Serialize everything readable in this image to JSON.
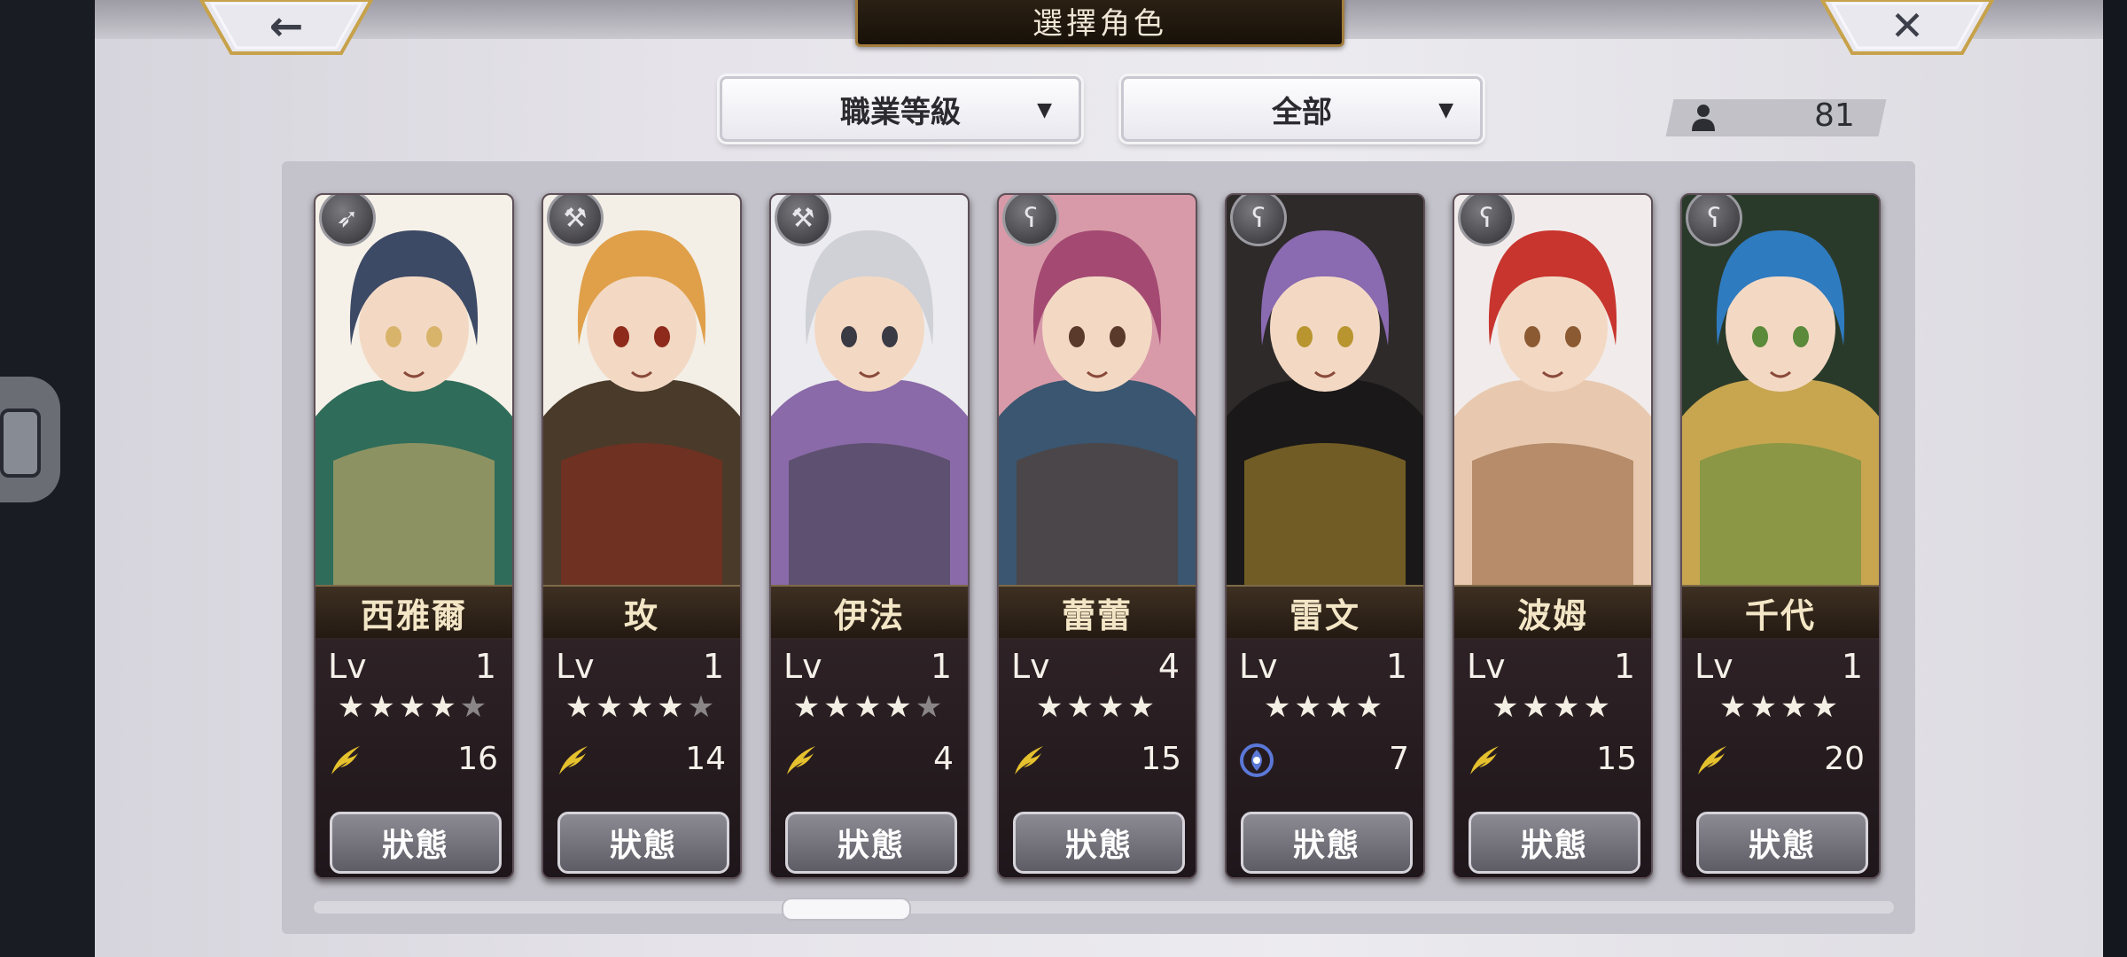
{
  "header": {
    "title": "選擇角色",
    "back_icon": "←",
    "close_icon": "✕"
  },
  "filters": {
    "job": {
      "label": "職業等級",
      "caret": "▼"
    },
    "scope": {
      "label": "全部",
      "caret": "▼"
    }
  },
  "owned_count": {
    "icon": "person-icon",
    "value": "81"
  },
  "cards": [
    {
      "name": "西雅爾",
      "class_icon": "bow-icon",
      "class_glyph": "➶",
      "level_label": "Lv",
      "level": "1",
      "stars_filled": 4,
      "stars_total": 5,
      "element_icon": "wind-feather-icon",
      "element_value": "16",
      "status": "狀態",
      "palette": [
        "#f6f1e8",
        "#3d4a66",
        "#d8b36a",
        "#2f6c5a"
      ]
    },
    {
      "name": "玫",
      "class_icon": "hammer-icon",
      "class_glyph": "⚒",
      "level_label": "Lv",
      "level": "1",
      "stars_filled": 4,
      "stars_total": 5,
      "element_icon": "wind-feather-icon",
      "element_value": "14",
      "status": "狀態",
      "palette": [
        "#f3efe7",
        "#e0a04a",
        "#8e2a1c",
        "#4a3a2a"
      ]
    },
    {
      "name": "伊法",
      "class_icon": "hammer-icon",
      "class_glyph": "⚒",
      "level_label": "Lv",
      "level": "1",
      "stars_filled": 4,
      "stars_total": 5,
      "element_icon": "wind-feather-icon",
      "element_value": "4",
      "status": "狀態",
      "palette": [
        "#ecebef",
        "#cfd1d6",
        "#3a3a44",
        "#8a6aa8"
      ]
    },
    {
      "name": "蕾蕾",
      "class_icon": "staff-icon",
      "class_glyph": "ʕ",
      "level_label": "Lv",
      "level": "4",
      "stars_filled": 4,
      "stars_total": 4,
      "element_icon": "wind-feather-icon",
      "element_value": "15",
      "status": "狀態",
      "palette": [
        "#d89aa8",
        "#a44a72",
        "#5a3a2a",
        "#3a5670"
      ]
    },
    {
      "name": "雷文",
      "class_icon": "staff-icon",
      "class_glyph": "ʕ",
      "level_label": "Lv",
      "level": "1",
      "stars_filled": 4,
      "stars_total": 4,
      "element_icon": "water-swirl-icon",
      "element_value": "7",
      "status": "狀態",
      "palette": [
        "#2e2a2a",
        "#8a6ab0",
        "#b8952f",
        "#1a1818"
      ]
    },
    {
      "name": "波姆",
      "class_icon": "staff-icon",
      "class_glyph": "ʕ",
      "level_label": "Lv",
      "level": "1",
      "stars_filled": 4,
      "stars_total": 4,
      "element_icon": "wind-feather-icon",
      "element_value": "15",
      "status": "狀態",
      "palette": [
        "#f1eceb",
        "#c8352e",
        "#8c5a32",
        "#e8c9b0"
      ]
    },
    {
      "name": "千代",
      "class_icon": "staff-icon",
      "class_glyph": "ʕ",
      "level_label": "Lv",
      "level": "1",
      "stars_filled": 4,
      "stars_total": 4,
      "element_icon": "wind-feather-icon",
      "element_value": "20",
      "status": "狀態",
      "palette": [
        "#2a3a2a",
        "#2f7bc0",
        "#5a8a3a",
        "#c8a650"
      ]
    }
  ],
  "colors": {
    "title_plate": "#231a0f",
    "gold_trim": "#a47e3f",
    "wind_element": "#e6c12e",
    "water_element": "#5b78d8"
  }
}
